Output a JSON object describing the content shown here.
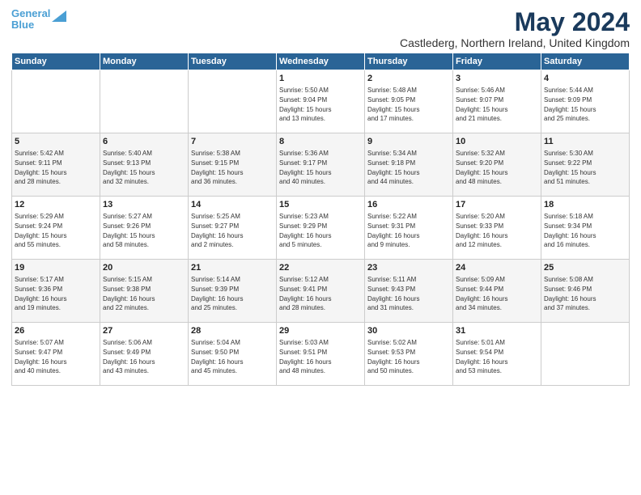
{
  "logo": {
    "line1": "General",
    "line2": "Blue",
    "arrow_color": "#4a9fd4"
  },
  "title": "May 2024",
  "subtitle": "Castlederg, Northern Ireland, United Kingdom",
  "header_days": [
    "Sunday",
    "Monday",
    "Tuesday",
    "Wednesday",
    "Thursday",
    "Friday",
    "Saturday"
  ],
  "weeks": [
    [
      {
        "day": "",
        "info": ""
      },
      {
        "day": "",
        "info": ""
      },
      {
        "day": "",
        "info": ""
      },
      {
        "day": "1",
        "info": "Sunrise: 5:50 AM\nSunset: 9:04 PM\nDaylight: 15 hours\nand 13 minutes."
      },
      {
        "day": "2",
        "info": "Sunrise: 5:48 AM\nSunset: 9:05 PM\nDaylight: 15 hours\nand 17 minutes."
      },
      {
        "day": "3",
        "info": "Sunrise: 5:46 AM\nSunset: 9:07 PM\nDaylight: 15 hours\nand 21 minutes."
      },
      {
        "day": "4",
        "info": "Sunrise: 5:44 AM\nSunset: 9:09 PM\nDaylight: 15 hours\nand 25 minutes."
      }
    ],
    [
      {
        "day": "5",
        "info": "Sunrise: 5:42 AM\nSunset: 9:11 PM\nDaylight: 15 hours\nand 28 minutes."
      },
      {
        "day": "6",
        "info": "Sunrise: 5:40 AM\nSunset: 9:13 PM\nDaylight: 15 hours\nand 32 minutes."
      },
      {
        "day": "7",
        "info": "Sunrise: 5:38 AM\nSunset: 9:15 PM\nDaylight: 15 hours\nand 36 minutes."
      },
      {
        "day": "8",
        "info": "Sunrise: 5:36 AM\nSunset: 9:17 PM\nDaylight: 15 hours\nand 40 minutes."
      },
      {
        "day": "9",
        "info": "Sunrise: 5:34 AM\nSunset: 9:18 PM\nDaylight: 15 hours\nand 44 minutes."
      },
      {
        "day": "10",
        "info": "Sunrise: 5:32 AM\nSunset: 9:20 PM\nDaylight: 15 hours\nand 48 minutes."
      },
      {
        "day": "11",
        "info": "Sunrise: 5:30 AM\nSunset: 9:22 PM\nDaylight: 15 hours\nand 51 minutes."
      }
    ],
    [
      {
        "day": "12",
        "info": "Sunrise: 5:29 AM\nSunset: 9:24 PM\nDaylight: 15 hours\nand 55 minutes."
      },
      {
        "day": "13",
        "info": "Sunrise: 5:27 AM\nSunset: 9:26 PM\nDaylight: 15 hours\nand 58 minutes."
      },
      {
        "day": "14",
        "info": "Sunrise: 5:25 AM\nSunset: 9:27 PM\nDaylight: 16 hours\nand 2 minutes."
      },
      {
        "day": "15",
        "info": "Sunrise: 5:23 AM\nSunset: 9:29 PM\nDaylight: 16 hours\nand 5 minutes."
      },
      {
        "day": "16",
        "info": "Sunrise: 5:22 AM\nSunset: 9:31 PM\nDaylight: 16 hours\nand 9 minutes."
      },
      {
        "day": "17",
        "info": "Sunrise: 5:20 AM\nSunset: 9:33 PM\nDaylight: 16 hours\nand 12 minutes."
      },
      {
        "day": "18",
        "info": "Sunrise: 5:18 AM\nSunset: 9:34 PM\nDaylight: 16 hours\nand 16 minutes."
      }
    ],
    [
      {
        "day": "19",
        "info": "Sunrise: 5:17 AM\nSunset: 9:36 PM\nDaylight: 16 hours\nand 19 minutes."
      },
      {
        "day": "20",
        "info": "Sunrise: 5:15 AM\nSunset: 9:38 PM\nDaylight: 16 hours\nand 22 minutes."
      },
      {
        "day": "21",
        "info": "Sunrise: 5:14 AM\nSunset: 9:39 PM\nDaylight: 16 hours\nand 25 minutes."
      },
      {
        "day": "22",
        "info": "Sunrise: 5:12 AM\nSunset: 9:41 PM\nDaylight: 16 hours\nand 28 minutes."
      },
      {
        "day": "23",
        "info": "Sunrise: 5:11 AM\nSunset: 9:43 PM\nDaylight: 16 hours\nand 31 minutes."
      },
      {
        "day": "24",
        "info": "Sunrise: 5:09 AM\nSunset: 9:44 PM\nDaylight: 16 hours\nand 34 minutes."
      },
      {
        "day": "25",
        "info": "Sunrise: 5:08 AM\nSunset: 9:46 PM\nDaylight: 16 hours\nand 37 minutes."
      }
    ],
    [
      {
        "day": "26",
        "info": "Sunrise: 5:07 AM\nSunset: 9:47 PM\nDaylight: 16 hours\nand 40 minutes."
      },
      {
        "day": "27",
        "info": "Sunrise: 5:06 AM\nSunset: 9:49 PM\nDaylight: 16 hours\nand 43 minutes."
      },
      {
        "day": "28",
        "info": "Sunrise: 5:04 AM\nSunset: 9:50 PM\nDaylight: 16 hours\nand 45 minutes."
      },
      {
        "day": "29",
        "info": "Sunrise: 5:03 AM\nSunset: 9:51 PM\nDaylight: 16 hours\nand 48 minutes."
      },
      {
        "day": "30",
        "info": "Sunrise: 5:02 AM\nSunset: 9:53 PM\nDaylight: 16 hours\nand 50 minutes."
      },
      {
        "day": "31",
        "info": "Sunrise: 5:01 AM\nSunset: 9:54 PM\nDaylight: 16 hours\nand 53 minutes."
      },
      {
        "day": "",
        "info": ""
      }
    ]
  ]
}
